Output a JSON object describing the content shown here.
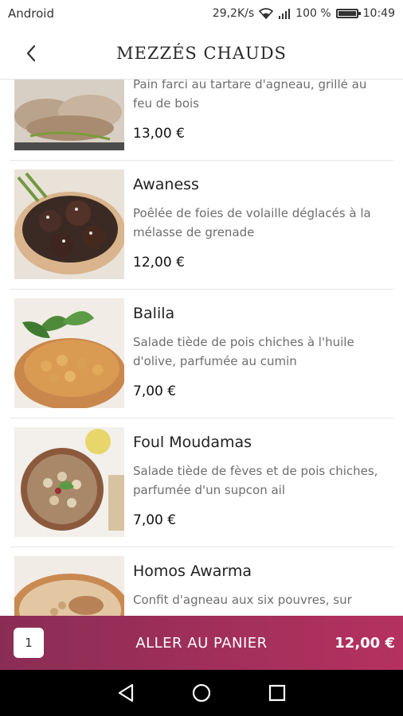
{
  "status": {
    "carrier": "Android",
    "speed": "29,2K/s",
    "battery": "100 %",
    "time": "10:49",
    "battery_level": 1.0
  },
  "header": {
    "title": "MEZZÉS CHAUDS",
    "back_icon": "chevron-left-icon"
  },
  "items": [
    {
      "name": "",
      "description": "Pain farci au tartare d'agneau, grillé au feu de bois",
      "price": "13,00 €"
    },
    {
      "name": "Awaness",
      "description": "Poêlée de foies de volaille déglacés à la mélasse de grenade",
      "price": "12,00 €"
    },
    {
      "name": "Balila",
      "description": "Salade  tiède de pois chiches à l'huile d'olive, parfumée au cumin",
      "price": "7,00 €"
    },
    {
      "name": "Foul Moudamas",
      "description": "Salade tiède de fèves et de pois chiches, parfumée d'un supcon ail",
      "price": "7,00 €"
    },
    {
      "name": "Homos Awarma",
      "description": "Confit d'agneau aux six pouvres, sur",
      "price": ""
    }
  ],
  "cart": {
    "quantity": "1",
    "label": "ALLER AU PANIER",
    "total": "12,00 €",
    "color_start": "#8a2d55",
    "color_end": "#b5315f"
  },
  "nav": {
    "back_icon": "triangle-back-icon",
    "home_icon": "circle-home-icon",
    "recents_icon": "square-recents-icon"
  }
}
